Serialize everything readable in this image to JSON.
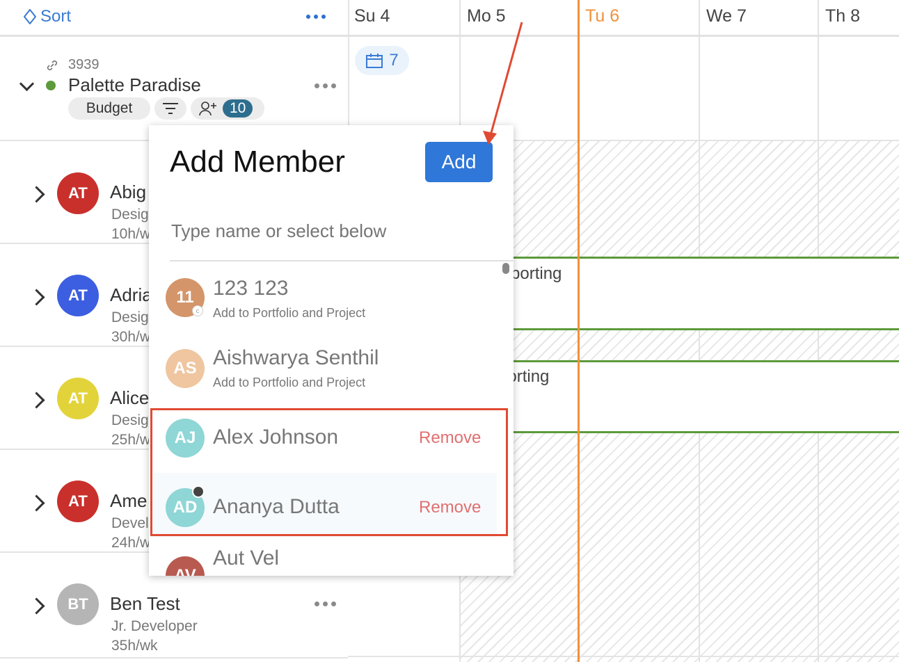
{
  "sidebar": {
    "sort_label": "Sort",
    "project": {
      "id": "3939",
      "name": "Palette Paradise",
      "budget_label": "Budget",
      "member_count": "10",
      "status_color": "#5c9a3b"
    },
    "members": [
      {
        "initials": "AT",
        "name": "Abig",
        "role": "Desig",
        "hours": "10h/w",
        "color": "#c9302c"
      },
      {
        "initials": "AT",
        "name": "Adria",
        "role": "Desig",
        "hours": "30h/w",
        "color": "#3c5ee0"
      },
      {
        "initials": "AT",
        "name": "Alice",
        "role": "Desig",
        "hours": "25h/w",
        "color": "#e3d33a"
      },
      {
        "initials": "AT",
        "name": "Ame",
        "role": "Devel",
        "hours": "24h/w",
        "color": "#c9302c"
      },
      {
        "initials": "BT",
        "name": "Ben Test",
        "role": "Jr. Developer",
        "hours": "35h/wk",
        "color": "#b5b5b5"
      }
    ]
  },
  "calendar": {
    "days": [
      {
        "label": "Su 4",
        "today": false
      },
      {
        "label": "Mo 5",
        "today": false
      },
      {
        "label": "Tu 6",
        "today": true
      },
      {
        "label": "We 7",
        "today": false
      },
      {
        "label": "Th 8",
        "today": false
      }
    ],
    "project_badge_count": "7",
    "bar_labels": [
      "porting",
      "porting"
    ],
    "today_color": "#f0913a"
  },
  "popup": {
    "title": "Add Member",
    "add_button": "Add",
    "search_placeholder": "Type name or select below",
    "items": [
      {
        "initials": "11",
        "name": "123 123",
        "sub": "Add to Portfolio and Project",
        "color": "#d4956a"
      },
      {
        "initials": "AS",
        "name": "Aishwarya Senthil",
        "sub": "Add to Portfolio and Project",
        "color": "#efc6a0"
      },
      {
        "initials": "AJ",
        "name": "Alex Johnson",
        "action": "Remove",
        "color": "#8fd6d6"
      },
      {
        "initials": "AD",
        "name": "Ananya Dutta",
        "action": "Remove",
        "color": "#8fd6d6"
      },
      {
        "initials": "AV",
        "name": "Aut Vel",
        "color": "#b85a50"
      }
    ]
  },
  "annotation": {
    "highlight_color": "#e04a32"
  }
}
